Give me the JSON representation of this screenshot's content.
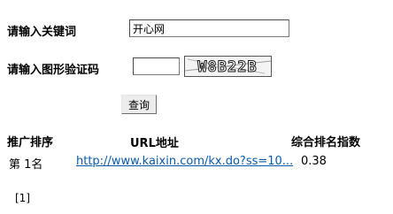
{
  "form": {
    "keyword_label": "请输入关键词",
    "keyword_value": "开心网",
    "captcha_label": "请输入图形验证码",
    "captcha_value": "",
    "captcha_text": "W8B22B",
    "submit_label": "查询"
  },
  "results": {
    "headers": [
      "推广排序",
      "URL地址",
      "综合排名指数"
    ],
    "rows": [
      {
        "rank": "第 1名",
        "url": "http://www.kaixin.com/kx.do?ss=10...",
        "score": "0.38"
      }
    ]
  },
  "pagination": {
    "pages": [
      "[1]"
    ]
  }
}
